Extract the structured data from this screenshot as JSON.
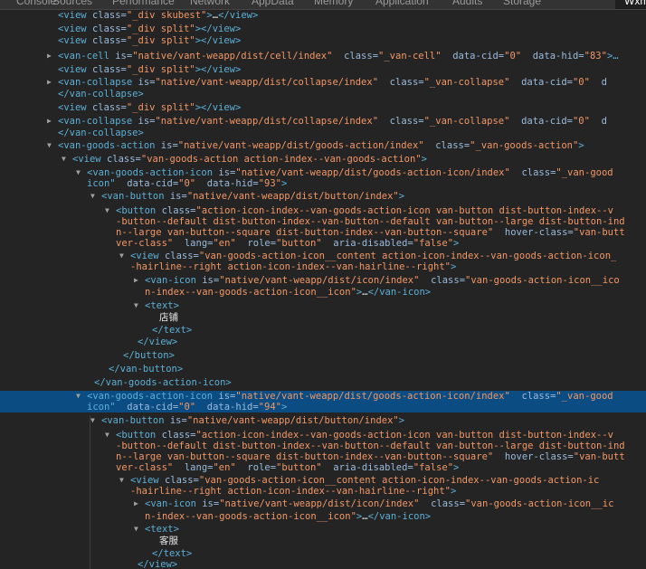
{
  "tabs": [
    "Console",
    "Sources",
    "Performance",
    "Network",
    "AppData",
    "Memory",
    "Application",
    "Audits",
    "Storage",
    "Wxml"
  ],
  "active_tab": "Wxml",
  "colors": {
    "tag": "#5db0d7",
    "attr_name": "#9bbbdc",
    "attr_value": "#f29766",
    "selected_row": "#0b4c82",
    "background": "#242424"
  },
  "lines": [
    {
      "indent": 64,
      "arrow": "",
      "parts": [
        [
          "tag",
          "<view "
        ],
        [
          "an",
          "class="
        ],
        [
          "av",
          "\"_div skubest\""
        ],
        [
          "tag",
          ">"
        ],
        [
          "tx",
          "…"
        ],
        [
          "tag",
          "</view>"
        ]
      ]
    },
    {
      "indent": 64,
      "arrow": "",
      "parts": [
        [
          "tag",
          "<view "
        ],
        [
          "an",
          "class="
        ],
        [
          "av",
          "\"_div split\""
        ],
        [
          "tag",
          "></view>"
        ]
      ]
    },
    {
      "indent": 64,
      "arrow": "",
      "parts": [
        [
          "tag",
          "<view "
        ],
        [
          "an",
          "class="
        ],
        [
          "av",
          "\"_div split\""
        ],
        [
          "tag",
          "></view>"
        ]
      ]
    },
    {
      "indent": 64,
      "arrow": "▶",
      "parts": [
        [
          "tag",
          "<van-cell "
        ],
        [
          "an",
          "is="
        ],
        [
          "av",
          "\"native/vant-weapp/dist/cell/index\""
        ],
        [
          "an",
          "  class="
        ],
        [
          "av",
          "\"_van-cell\""
        ],
        [
          "an",
          "  data-cid="
        ],
        [
          "av",
          "\"0\""
        ],
        [
          "an",
          "  data-hid="
        ],
        [
          "av",
          "\"83\""
        ],
        [
          "tag",
          ">…"
        ]
      ]
    },
    {
      "indent": 64,
      "arrow": "",
      "parts": [
        [
          "tag",
          "<view "
        ],
        [
          "an",
          "class="
        ],
        [
          "av",
          "\"_div split\""
        ],
        [
          "tag",
          "></view>"
        ]
      ]
    },
    {
      "indent": 64,
      "arrow": "▶",
      "parts": [
        [
          "tag",
          "<van-collapse "
        ],
        [
          "an",
          "is="
        ],
        [
          "av",
          "\"native/vant-weapp/dist/collapse/index\""
        ],
        [
          "an",
          "  class="
        ],
        [
          "av",
          "\"_van-collapse\""
        ],
        [
          "an",
          "  data-cid="
        ],
        [
          "av",
          "\"0\""
        ],
        [
          "an",
          "  d"
        ]
      ]
    },
    {
      "indent": 64,
      "arrow": "",
      "parts": [
        [
          "tag",
          "</van-collapse>"
        ]
      ]
    },
    {
      "indent": 64,
      "arrow": "",
      "parts": [
        [
          "tag",
          "<view "
        ],
        [
          "an",
          "class="
        ],
        [
          "av",
          "\"_div split\""
        ],
        [
          "tag",
          "></view>"
        ]
      ]
    },
    {
      "indent": 64,
      "arrow": "▶",
      "parts": [
        [
          "tag",
          "<van-collapse "
        ],
        [
          "an",
          "is="
        ],
        [
          "av",
          "\"native/vant-weapp/dist/collapse/index\""
        ],
        [
          "an",
          "  class="
        ],
        [
          "av",
          "\"_van-collapse\""
        ],
        [
          "an",
          "  data-cid="
        ],
        [
          "av",
          "\"0\""
        ],
        [
          "an",
          "  d"
        ]
      ]
    },
    {
      "indent": 64,
      "arrow": "",
      "parts": [
        [
          "tag",
          "</van-collapse>"
        ]
      ]
    },
    {
      "indent": 64,
      "arrow": "▼",
      "parts": [
        [
          "tag",
          "<van-goods-action "
        ],
        [
          "an",
          "is="
        ],
        [
          "av",
          "\"native/vant-weapp/dist/goods-action/index\""
        ],
        [
          "an",
          "  class="
        ],
        [
          "av",
          "\"_van-goods-action\""
        ],
        [
          "tag",
          ">"
        ]
      ]
    },
    {
      "indent": 80,
      "arrow": "▼",
      "parts": [
        [
          "tag",
          "<view "
        ],
        [
          "an",
          "class="
        ],
        [
          "av",
          "\"van-goods-action action-index--van-goods-action\""
        ],
        [
          "tag",
          ">"
        ]
      ]
    },
    {
      "indent": 96,
      "arrow": "▼",
      "parts": [
        [
          "tag",
          "<van-goods-action-icon "
        ],
        [
          "an",
          "is="
        ],
        [
          "av",
          "\"native/vant-weapp/dist/goods-action-icon/index\""
        ],
        [
          "an",
          "  class="
        ],
        [
          "av",
          "\"_van-good"
        ]
      ]
    },
    {
      "indent": 96,
      "arrow": "",
      "parts": [
        [
          "tag",
          "icon\""
        ],
        [
          "an",
          "  data-cid="
        ],
        [
          "av",
          "\"0\""
        ],
        [
          "an",
          "  data-hid="
        ],
        [
          "av",
          "\"93\""
        ],
        [
          "tag",
          ">"
        ]
      ]
    },
    {
      "indent": 112,
      "arrow": "▼",
      "parts": [
        [
          "tag",
          "<van-button "
        ],
        [
          "an",
          "is="
        ],
        [
          "av",
          "\"native/vant-weapp/dist/button/index\""
        ],
        [
          "tag",
          ">"
        ]
      ]
    },
    {
      "indent": 128,
      "arrow": "▼",
      "parts": [
        [
          "tag",
          "<button "
        ],
        [
          "an",
          "class="
        ],
        [
          "av",
          "\"action-icon-index--van-goods-action-icon van-button dist-button-index--v"
        ]
      ]
    },
    {
      "indent": 128,
      "arrow": "",
      "parts": [
        [
          "av",
          "-button--default dist-button-index--van-button--default van-button--large dist-button-ind"
        ]
      ]
    },
    {
      "indent": 128,
      "arrow": "",
      "parts": [
        [
          "av",
          "n--large van-button--square dist-button-index--van-button--square\""
        ],
        [
          "an",
          "  hover-class="
        ],
        [
          "av",
          "\"van-butt"
        ]
      ]
    },
    {
      "indent": 128,
      "arrow": "",
      "parts": [
        [
          "av",
          "ver-class\""
        ],
        [
          "an",
          "  lang="
        ],
        [
          "av",
          "\"en\""
        ],
        [
          "an",
          "  role="
        ],
        [
          "av",
          "\"button\""
        ],
        [
          "an",
          "  aria-disabled="
        ],
        [
          "av",
          "\"false\""
        ],
        [
          "tag",
          ">"
        ]
      ]
    },
    {
      "indent": 144,
      "arrow": "▼",
      "parts": [
        [
          "tag",
          "<view "
        ],
        [
          "an",
          "class="
        ],
        [
          "av",
          "\"van-goods-action-icon__content action-icon-index--van-goods-action-icon_"
        ]
      ]
    },
    {
      "indent": 144,
      "arrow": "",
      "parts": [
        [
          "av",
          "-hairline--right action-icon-index--van-hairline--right\""
        ],
        [
          "tag",
          ">"
        ]
      ]
    },
    {
      "indent": 160,
      "arrow": "▶",
      "parts": [
        [
          "tag",
          "<van-icon "
        ],
        [
          "an",
          "is="
        ],
        [
          "av",
          "\"native/vant-weapp/dist/icon/index\""
        ],
        [
          "an",
          "  class="
        ],
        [
          "av",
          "\"van-goods-action-icon__ico"
        ]
      ]
    },
    {
      "indent": 160,
      "arrow": "",
      "parts": [
        [
          "av",
          "n-index--van-goods-action-icon__icon\""
        ],
        [
          "tag",
          ">"
        ],
        [
          "tx",
          "…"
        ],
        [
          "tag",
          "</van-icon>"
        ]
      ]
    },
    {
      "indent": 160,
      "arrow": "▼",
      "parts": [
        [
          "tag",
          "<text>"
        ]
      ]
    },
    {
      "indent": 176,
      "arrow": "",
      "parts": [
        [
          "tx",
          "店铺"
        ]
      ]
    },
    {
      "indent": 168,
      "arrow": "",
      "parts": [
        [
          "tag",
          "</text>"
        ]
      ]
    },
    {
      "indent": 152,
      "arrow": "",
      "parts": [
        [
          "tag",
          "</view>"
        ]
      ]
    },
    {
      "indent": 136,
      "arrow": "",
      "parts": [
        [
          "tag",
          "</button>"
        ]
      ]
    },
    {
      "indent": 120,
      "arrow": "",
      "parts": [
        [
          "tag",
          "</van-button>"
        ]
      ]
    },
    {
      "indent": 104,
      "arrow": "",
      "parts": [
        [
          "tag",
          "</van-goods-action-icon>"
        ]
      ]
    },
    {
      "indent": 96,
      "arrow": "▼",
      "sel": true,
      "parts": [
        [
          "tag",
          "<van-goods-action-icon "
        ],
        [
          "an",
          "is="
        ],
        [
          "av",
          "\"native/vant-weapp/dist/goods-action-icon/index\""
        ],
        [
          "an",
          "  class="
        ],
        [
          "av",
          "\"_van-good"
        ]
      ]
    },
    {
      "indent": 96,
      "arrow": "",
      "sel": true,
      "parts": [
        [
          "tag",
          "icon\""
        ],
        [
          "an",
          "  data-cid="
        ],
        [
          "av",
          "\"0\""
        ],
        [
          "an",
          "  data-hid="
        ],
        [
          "av",
          "\"94\""
        ],
        [
          "tag",
          ">"
        ]
      ]
    },
    {
      "indent": 112,
      "arrow": "▼",
      "parts": [
        [
          "tag",
          "<van-button "
        ],
        [
          "an",
          "is="
        ],
        [
          "av",
          "\"native/vant-weapp/dist/button/index\""
        ],
        [
          "tag",
          ">"
        ]
      ]
    },
    {
      "indent": 128,
      "arrow": "▼",
      "parts": [
        [
          "tag",
          "<button "
        ],
        [
          "an",
          "class="
        ],
        [
          "av",
          "\"action-icon-index--van-goods-action-icon van-button dist-button-index--v"
        ]
      ]
    },
    {
      "indent": 128,
      "arrow": "",
      "parts": [
        [
          "av",
          "-button--default dist-button-index--van-button--default van-button--large dist-button-ind"
        ]
      ]
    },
    {
      "indent": 128,
      "arrow": "",
      "parts": [
        [
          "av",
          "n--large van-button--square dist-button-index--van-button--square\""
        ],
        [
          "an",
          "  hover-class="
        ],
        [
          "av",
          "\"van-butt"
        ]
      ]
    },
    {
      "indent": 128,
      "arrow": "",
      "parts": [
        [
          "av",
          "ver-class\""
        ],
        [
          "an",
          "  lang="
        ],
        [
          "av",
          "\"en\""
        ],
        [
          "an",
          "  role="
        ],
        [
          "av",
          "\"button\""
        ],
        [
          "an",
          "  aria-disabled="
        ],
        [
          "av",
          "\"false\""
        ],
        [
          "tag",
          ">"
        ]
      ]
    },
    {
      "indent": 144,
      "arrow": "▼",
      "parts": [
        [
          "tag",
          "<view "
        ],
        [
          "an",
          "class="
        ],
        [
          "av",
          "\"van-goods-action-icon__content action-icon-index--van-goods-action-ic"
        ]
      ]
    },
    {
      "indent": 144,
      "arrow": "",
      "parts": [
        [
          "av",
          "-hairline--right action-icon-index--van-hairline--right\""
        ],
        [
          "tag",
          ">"
        ]
      ]
    },
    {
      "indent": 160,
      "arrow": "▶",
      "parts": [
        [
          "tag",
          "<van-icon "
        ],
        [
          "an",
          "is="
        ],
        [
          "av",
          "\"native/vant-weapp/dist/icon/index\""
        ],
        [
          "an",
          "  class="
        ],
        [
          "av",
          "\"van-goods-action-icon__ic"
        ]
      ]
    },
    {
      "indent": 160,
      "arrow": "",
      "parts": [
        [
          "av",
          "n-index--van-goods-action-icon__icon\""
        ],
        [
          "tag",
          ">"
        ],
        [
          "tx",
          "…"
        ],
        [
          "tag",
          "</van-icon>"
        ]
      ]
    },
    {
      "indent": 160,
      "arrow": "▼",
      "parts": [
        [
          "tag",
          "<text>"
        ]
      ]
    },
    {
      "indent": 176,
      "arrow": "",
      "parts": [
        [
          "tx",
          "客服"
        ]
      ]
    },
    {
      "indent": 168,
      "arrow": "",
      "parts": [
        [
          "tag",
          "</text>"
        ]
      ]
    },
    {
      "indent": 152,
      "arrow": "",
      "parts": [
        [
          "tag",
          "</view>"
        ]
      ]
    }
  ]
}
